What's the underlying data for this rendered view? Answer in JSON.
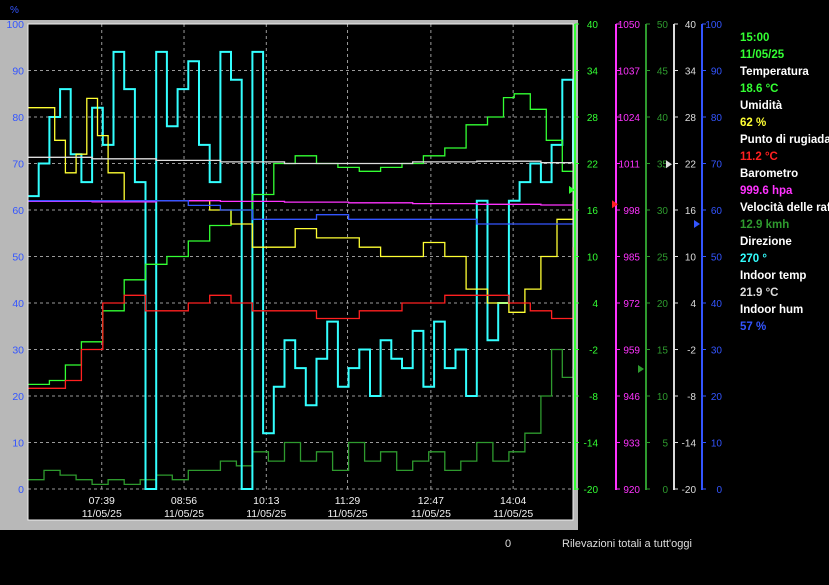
{
  "window": {
    "percent_axis_label": "%",
    "footer_count": "0",
    "footer_label": "Rilevazioni totali a tutt'oggi"
  },
  "readout": {
    "time": "15:00",
    "date": "11/05/25",
    "items": [
      {
        "label": "Temperatura",
        "value": "18.6 °C",
        "color": "#33ff33"
      },
      {
        "label": "Umidità",
        "value": "62 %",
        "color": "#ffff33"
      },
      {
        "label": "Punto di rugiada",
        "value": "11.2 °C",
        "color": "#ff2020"
      },
      {
        "label": "Barometro",
        "value": "999.6 hpa",
        "color": "#ff33ff"
      },
      {
        "label": "Velocità delle raffiche",
        "value": "12.9 kmh",
        "color": "#2e9a2e"
      },
      {
        "label": "Direzione",
        "value": "270 °",
        "color": "#33ffff"
      },
      {
        "label": "Indoor temp",
        "value": "21.9 °C",
        "color": "#dddddd"
      },
      {
        "label": "Indoor hum",
        "value": "57 %",
        "color": "#3355ff"
      }
    ]
  },
  "chart_data": {
    "type": "line",
    "x_ticks": [
      {
        "time": "07:39",
        "date": "11/05/25"
      },
      {
        "time": "08:56",
        "date": "11/05/25"
      },
      {
        "time": "10:13",
        "date": "11/05/25"
      },
      {
        "time": "11:29",
        "date": "11/05/25"
      },
      {
        "time": "12:47",
        "date": "11/05/25"
      },
      {
        "time": "14:04",
        "date": "11/05/25"
      }
    ],
    "x_range": [
      "06:30",
      "15:00"
    ],
    "grid": true,
    "axes": [
      {
        "id": "pct",
        "position": "left",
        "color": "#3355ff",
        "min": 0,
        "max": 100,
        "ticks": [
          "0",
          "10",
          "20",
          "30",
          "40",
          "50",
          "60",
          "70",
          "80",
          "90",
          "100"
        ]
      },
      {
        "id": "temp",
        "position": "right-1",
        "color": "#33ff33",
        "min": -20,
        "max": 40,
        "ticks": [
          "-20",
          "-14",
          "-8",
          "-2",
          "4",
          "10",
          "16",
          "22",
          "28",
          "34",
          "40"
        ]
      },
      {
        "id": "baro",
        "position": "right-2",
        "color": "#ff33ff",
        "min": 920,
        "max": 1050,
        "ticks": [
          "920",
          "933",
          "946",
          "959",
          "972",
          "985",
          "998",
          "1011",
          "1024",
          "1037",
          "1050"
        ]
      },
      {
        "id": "wind",
        "position": "right-3",
        "color": "#2e9a2e",
        "min": 0,
        "max": 50,
        "ticks": [
          "0",
          "5",
          "10",
          "15",
          "20",
          "25",
          "30",
          "35",
          "40",
          "45",
          "50"
        ]
      },
      {
        "id": "indoor_temp",
        "position": "right-4",
        "color": "#dddddd",
        "min": -20,
        "max": 40,
        "ticks": [
          "-20",
          "-14",
          "-8",
          "-2",
          "4",
          "10",
          "16",
          "22",
          "28",
          "34",
          "40"
        ]
      },
      {
        "id": "indoor_hum",
        "position": "right-5",
        "color": "#3355ff",
        "min": 0,
        "max": 100,
        "ticks": [
          "0",
          "10",
          "20",
          "30",
          "40",
          "50",
          "60",
          "70",
          "80",
          "90",
          "100"
        ]
      }
    ],
    "series": [
      {
        "id": "temperatura",
        "axis": "temp",
        "color": "#33ff33",
        "x": [
          "06:30",
          "06:50",
          "07:05",
          "07:20",
          "07:40",
          "08:00",
          "08:20",
          "08:40",
          "09:00",
          "09:20",
          "09:40",
          "10:00",
          "10:20",
          "10:40",
          "11:00",
          "11:20",
          "11:40",
          "12:00",
          "12:20",
          "12:40",
          "13:00",
          "13:20",
          "13:40",
          "13:55",
          "14:05",
          "14:20",
          "14:35",
          "14:50",
          "15:00"
        ],
        "y": [
          -6.5,
          -6,
          -4,
          -1,
          3,
          7,
          9,
          10,
          12,
          14,
          16,
          18,
          22,
          23,
          22,
          21.5,
          21,
          21.5,
          22,
          23,
          24,
          27,
          28,
          30.5,
          31,
          29,
          25,
          21,
          18.6
        ]
      },
      {
        "id": "umidita",
        "axis": "pct",
        "color": "#ffff33",
        "x": [
          "06:30",
          "06:45",
          "06:55",
          "07:05",
          "07:15",
          "07:25",
          "07:35",
          "07:45",
          "08:00",
          "08:20",
          "08:40",
          "09:00",
          "09:20",
          "09:40",
          "10:00",
          "10:20",
          "10:40",
          "11:00",
          "11:20",
          "11:40",
          "12:00",
          "12:20",
          "12:40",
          "13:00",
          "13:20",
          "13:40",
          "14:00",
          "14:15",
          "14:30",
          "14:45",
          "15:00"
        ],
        "y": [
          82,
          82,
          75,
          68,
          72,
          84,
          76,
          68,
          62,
          62,
          62,
          62,
          60,
          57,
          52,
          52,
          56,
          54,
          54,
          52,
          50,
          50,
          53,
          50,
          43,
          40,
          38,
          43,
          50,
          58,
          62
        ]
      },
      {
        "id": "rugiada",
        "axis": "temp",
        "color": "#ff2020",
        "x": [
          "06:30",
          "06:50",
          "07:05",
          "07:20",
          "07:40",
          "08:00",
          "08:20",
          "08:40",
          "09:00",
          "09:20",
          "09:40",
          "10:00",
          "10:20",
          "10:40",
          "11:00",
          "11:20",
          "11:40",
          "12:00",
          "12:20",
          "12:40",
          "13:00",
          "13:20",
          "13:40",
          "14:00",
          "14:20",
          "14:40",
          "15:00"
        ],
        "y": [
          -7,
          -7,
          -6,
          -2,
          4,
          5,
          3,
          3,
          4,
          5,
          4,
          3,
          3,
          3,
          2,
          2,
          3,
          3,
          4,
          4,
          5,
          5,
          5,
          4,
          3,
          2,
          11.2
        ]
      },
      {
        "id": "barometro",
        "axis": "baro",
        "color": "#ff33ff",
        "x": [
          "06:30",
          "07:30",
          "08:30",
          "09:30",
          "10:30",
          "11:30",
          "12:30",
          "13:30",
          "14:30",
          "15:00"
        ],
        "y": [
          1000.4,
          1000.3,
          1000.6,
          1000.4,
          1000.2,
          1000.0,
          999.8,
          999.6,
          999.4,
          999.6
        ]
      },
      {
        "id": "indoor_temp",
        "axis": "indoor_temp",
        "color": "#dddddd",
        "x": [
          "06:30",
          "07:30",
          "08:30",
          "09:30",
          "10:30",
          "11:30",
          "12:30",
          "13:30",
          "14:30",
          "15:00"
        ],
        "y": [
          22.8,
          22.6,
          22.4,
          22.2,
          22.0,
          22.0,
          22.2,
          22.3,
          22.1,
          21.9
        ]
      },
      {
        "id": "indoor_hum",
        "axis": "indoor_hum",
        "color": "#3355ff",
        "x": [
          "06:30",
          "07:30",
          "08:30",
          "09:00",
          "09:30",
          "10:00",
          "10:30",
          "11:00",
          "11:30",
          "12:00",
          "12:30",
          "13:00",
          "13:30",
          "14:00",
          "14:30",
          "15:00"
        ],
        "y": [
          62,
          62,
          62,
          61,
          60,
          58,
          58,
          59,
          58,
          58,
          58,
          58,
          57,
          57,
          57,
          57
        ]
      },
      {
        "id": "velocita",
        "axis": "wind",
        "color": "#2e9a2e",
        "x": [
          "06:30",
          "06:45",
          "07:00",
          "07:15",
          "07:30",
          "07:45",
          "08:00",
          "08:15",
          "08:30",
          "08:45",
          "09:00",
          "09:15",
          "09:30",
          "09:45",
          "10:00",
          "10:15",
          "10:30",
          "10:45",
          "11:00",
          "11:15",
          "11:30",
          "11:45",
          "12:00",
          "12:15",
          "12:30",
          "12:45",
          "13:00",
          "13:15",
          "13:30",
          "13:45",
          "14:00",
          "14:15",
          "14:30",
          "14:40",
          "14:50",
          "15:00"
        ],
        "y": [
          1,
          2,
          1.5,
          1,
          0.5,
          1,
          0.5,
          1,
          1.5,
          1,
          2,
          2,
          3,
          2.5,
          4,
          3,
          5,
          3,
          4,
          2,
          5,
          3,
          4,
          2,
          3,
          4,
          2,
          3,
          5,
          3,
          4,
          6,
          10,
          15,
          12,
          12.9
        ]
      },
      {
        "id": "direzione",
        "axis": "pct",
        "color": "#33ffff",
        "x": [
          "06:30",
          "06:40",
          "06:50",
          "07:00",
          "07:10",
          "07:20",
          "07:30",
          "07:40",
          "07:50",
          "08:00",
          "08:10",
          "08:20",
          "08:30",
          "08:40",
          "08:50",
          "09:00",
          "09:10",
          "09:20",
          "09:30",
          "09:40",
          "09:50",
          "10:00",
          "10:10",
          "10:20",
          "10:30",
          "10:40",
          "10:50",
          "11:00",
          "11:10",
          "11:20",
          "11:30",
          "11:40",
          "11:50",
          "12:00",
          "12:10",
          "12:20",
          "12:30",
          "12:40",
          "12:50",
          "13:00",
          "13:10",
          "13:20",
          "13:30",
          "13:40",
          "13:50",
          "14:00",
          "14:10",
          "14:20",
          "14:30",
          "14:40",
          "14:50",
          "15:00"
        ],
        "y": [
          63,
          70,
          80,
          86,
          72,
          66,
          82,
          74,
          94,
          86,
          66,
          0,
          94,
          78,
          86,
          92,
          74,
          66,
          94,
          88,
          0,
          94,
          12,
          22,
          32,
          26,
          18,
          28,
          36,
          22,
          26,
          30,
          20,
          32,
          28,
          26,
          34,
          22,
          36,
          26,
          30,
          20,
          62,
          32,
          40,
          62,
          66,
          70,
          66,
          74,
          88,
          70
        ]
      }
    ]
  }
}
